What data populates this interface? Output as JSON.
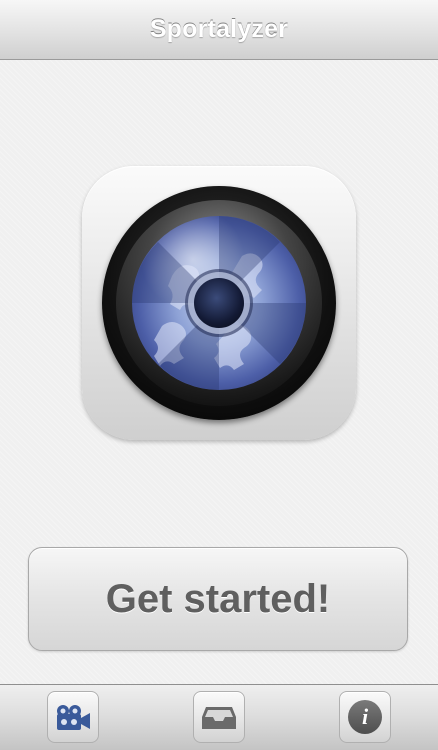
{
  "navbar": {
    "title": "Sportalyzer"
  },
  "main": {
    "app_icon": "camera-lens-icon",
    "cta_label": "Get started!"
  },
  "tabbar": {
    "tabs": [
      {
        "icon": "video-camera-icon",
        "selected": true,
        "color": "#3a5a9a"
      },
      {
        "icon": "inbox-tray-icon",
        "selected": false,
        "color": "#6a6a6a"
      },
      {
        "icon": "info-icon",
        "selected": false,
        "color": "#6a6a6a"
      }
    ],
    "info_glyph": "i"
  },
  "colors": {
    "navbar_gradient_top": "#f7f7f7",
    "navbar_gradient_bottom": "#cfcfcf",
    "background": "#f0f0f0",
    "button_text": "#5f5f5f",
    "accent_blue": "#3a5a9a"
  }
}
